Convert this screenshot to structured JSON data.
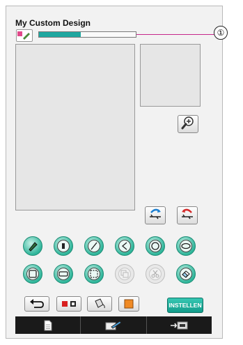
{
  "header": {
    "title": "My Custom Design",
    "callout_number": "①"
  },
  "progress": {
    "fraction": 0.43,
    "color": "#1fa7a0"
  },
  "side_buttons": {
    "zoom": "zoom-in-icon",
    "usb_save": "usb-save-icon",
    "usb_load": "usb-load-icon"
  },
  "tools": {
    "row1": [
      "line-type-pen",
      "fill-type",
      "straight-line",
      "zigzag-line",
      "circle",
      "oval"
    ],
    "row2": [
      "rectangle",
      "rounded-rectangle",
      "select-area",
      "duplicate",
      "cut",
      "eraser"
    ]
  },
  "bottom_bar": {
    "undo": "undo-icon",
    "thread_color": "color-swatch-icon",
    "fill_bucket": "bucket-icon",
    "stamp": "stamp-icon",
    "set_label": "INSTELLEN"
  },
  "tabs": [
    "new-file-icon",
    "edit-tools-icon",
    "sewing-machine-icon"
  ],
  "colors": {
    "accent": "#2fb59a",
    "callout_line": "#c6278a",
    "tab_bar": "#1a1a1a"
  }
}
